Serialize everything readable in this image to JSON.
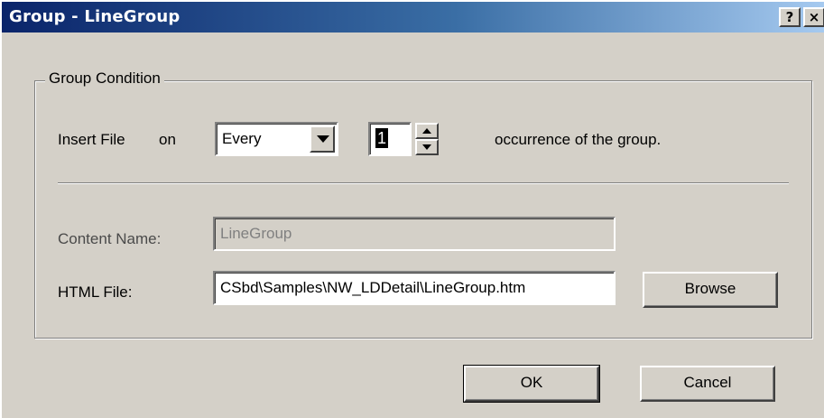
{
  "window": {
    "title": "Group - LineGroup",
    "help_glyph": "?",
    "close_glyph": "×"
  },
  "group_condition": {
    "legend": "Group Condition",
    "insert_label": "Insert File",
    "on_label": "on",
    "frequency_select": {
      "value": "Every",
      "icon": "chevron-down-icon"
    },
    "occurrence_spinner": {
      "value": "1"
    },
    "suffix_text": "occurrence of the group.",
    "content_name": {
      "label": "Content Name:",
      "value": "LineGroup",
      "enabled": false
    },
    "html_file": {
      "label": "HTML File:",
      "value": "CSbd\\Samples\\NW_LDDetail\\LineGroup.htm"
    },
    "browse_label": "Browse"
  },
  "footer": {
    "ok_label": "OK",
    "cancel_label": "Cancel"
  },
  "colors": {
    "dialog_face": "#d4d0c8",
    "titlebar_start": "#0a246a",
    "titlebar_end": "#a6caf0",
    "disabled_text": "#808080"
  }
}
